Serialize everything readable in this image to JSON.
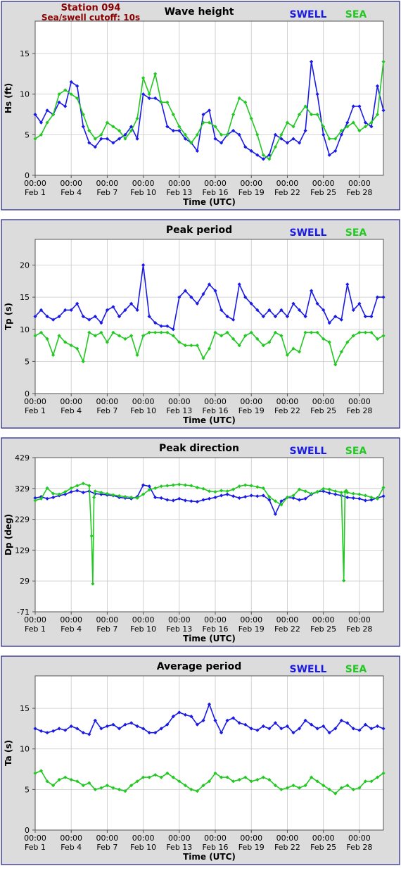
{
  "station": {
    "name": "Station 094",
    "cutoff": "Sea/swell cutoff: 10s"
  },
  "colors": {
    "swell": "#1a1ae6",
    "sea": "#22c822",
    "panel": "#dcdcdc",
    "border": "#1a1a8a"
  },
  "legend": {
    "swell": "SWELL",
    "sea": "SEA"
  },
  "x_axis": {
    "label": "Time (UTC)",
    "tick_days": [
      0,
      3,
      6,
      9,
      12,
      15,
      18,
      21,
      24,
      27
    ],
    "tick_labels_top": [
      "00:00",
      "00:00",
      "00:00",
      "00:00",
      "00:00",
      "00:00",
      "00:00",
      "00:00",
      "00:00",
      "00:00"
    ],
    "tick_labels_bottom": [
      "Feb 1",
      "Feb 4",
      "Feb 7",
      "Feb 10",
      "Feb 13",
      "Feb 16",
      "Feb 19",
      "Feb 22",
      "Feb 25",
      "Feb 28"
    ],
    "range_days": [
      0,
      29
    ]
  },
  "chart_data": [
    {
      "type": "line",
      "title": "Wave height",
      "ylabel": "Hs (ft)",
      "ylim": [
        0,
        19
      ],
      "yticks": [
        0,
        5,
        10,
        15
      ],
      "grid": true,
      "legend_position": "top-right",
      "x_unit": "days since Feb 1 00:00",
      "series": [
        {
          "name": "SWELL",
          "x": [
            0,
            0.5,
            1,
            1.5,
            2,
            2.5,
            3,
            3.5,
            4,
            4.5,
            5,
            5.5,
            6,
            6.5,
            7,
            7.5,
            8,
            8.5,
            9,
            9.5,
            10,
            10.5,
            11,
            11.5,
            12,
            12.5,
            13,
            13.5,
            14,
            14.5,
            15,
            15.5,
            16,
            16.5,
            17,
            17.5,
            18,
            18.5,
            19,
            19.5,
            20,
            20.5,
            21,
            21.5,
            22,
            22.5,
            23,
            23.5,
            24,
            24.5,
            25,
            25.5,
            26,
            26.5,
            27,
            27.5,
            28,
            28.5,
            29
          ],
          "values": [
            7.5,
            6.5,
            8,
            7.5,
            9,
            8.5,
            11.5,
            11,
            6,
            4,
            3.5,
            4.5,
            4.5,
            4,
            4.5,
            5,
            6,
            4.5,
            10,
            9.5,
            9.5,
            9,
            6,
            5.5,
            5.5,
            4.5,
            4,
            3,
            7.5,
            8,
            4.5,
            4,
            5,
            5.5,
            5,
            3.5,
            3,
            2.5,
            2,
            2.5,
            5,
            4.5,
            4,
            4.5,
            4,
            5.5,
            14,
            10,
            5,
            2.5,
            3,
            5,
            6.5,
            8.5,
            8.5,
            6.5,
            6,
            11,
            8
          ]
        },
        {
          "name": "SEA",
          "x": [
            0,
            0.5,
            1,
            1.5,
            2,
            2.5,
            3,
            3.5,
            4,
            4.5,
            5,
            5.5,
            6,
            6.5,
            7,
            7.5,
            8,
            8.5,
            9,
            9.5,
            10,
            10.5,
            11,
            11.5,
            12,
            12.5,
            13,
            13.5,
            14,
            14.5,
            15,
            15.5,
            16,
            16.5,
            17,
            17.5,
            18,
            18.5,
            19,
            19.5,
            20,
            20.5,
            21,
            21.5,
            22,
            22.5,
            23,
            23.5,
            24,
            24.5,
            25,
            25.5,
            26,
            26.5,
            27,
            27.5,
            28,
            28.5,
            29
          ],
          "values": [
            4.5,
            5,
            6.5,
            7.5,
            10,
            10.5,
            10,
            9.5,
            7.5,
            5.5,
            4.5,
            5,
            6.5,
            6,
            5.5,
            4.5,
            5.5,
            7,
            12,
            10,
            12.5,
            9,
            9,
            7.5,
            6,
            5,
            4,
            5,
            6.5,
            6.5,
            6,
            5,
            5,
            7.5,
            9.5,
            9,
            7,
            5,
            2.5,
            2,
            3.5,
            5,
            6.5,
            6,
            7.5,
            8.5,
            7.5,
            7.5,
            6,
            4.5,
            4.5,
            5.5,
            6,
            6.5,
            5.5,
            6,
            6.5,
            7.5,
            14
          ]
        }
      ]
    },
    {
      "type": "line",
      "title": "Peak period",
      "ylabel": "Tp (s)",
      "ylim": [
        0,
        24
      ],
      "yticks": [
        0,
        5,
        10,
        15,
        20
      ],
      "grid": true,
      "legend_position": "top-right",
      "x_unit": "days since Feb 1 00:00",
      "series": [
        {
          "name": "SWELL",
          "x": [
            0,
            0.5,
            1,
            1.5,
            2,
            2.5,
            3,
            3.5,
            4,
            4.5,
            5,
            5.5,
            6,
            6.5,
            7,
            7.5,
            8,
            8.5,
            9,
            9.5,
            10,
            10.5,
            11,
            11.5,
            12,
            12.5,
            13,
            13.5,
            14,
            14.5,
            15,
            15.5,
            16,
            16.5,
            17,
            17.5,
            18,
            18.5,
            19,
            19.5,
            20,
            20.5,
            21,
            21.5,
            22,
            22.5,
            23,
            23.5,
            24,
            24.5,
            25,
            25.5,
            26,
            26.5,
            27,
            27.5,
            28,
            28.5,
            29
          ],
          "values": [
            12,
            13,
            12,
            11.5,
            12,
            13,
            13,
            14,
            12,
            11.5,
            12,
            11,
            13,
            13.5,
            12,
            13,
            14,
            13,
            20,
            12,
            11,
            10.5,
            10.5,
            10,
            15,
            16,
            15,
            14,
            15.5,
            17,
            16,
            13,
            12,
            11.5,
            17,
            15,
            14,
            13,
            12,
            13,
            12,
            13,
            12,
            14,
            13,
            12,
            16,
            14,
            13,
            11,
            12,
            11.5,
            17,
            13,
            14,
            12,
            12,
            15,
            15
          ]
        },
        {
          "name": "SEA",
          "x": [
            0,
            0.5,
            1,
            1.5,
            2,
            2.5,
            3,
            3.5,
            4,
            4.5,
            5,
            5.5,
            6,
            6.5,
            7,
            7.5,
            8,
            8.5,
            9,
            9.5,
            10,
            10.5,
            11,
            11.5,
            12,
            12.5,
            13,
            13.5,
            14,
            14.5,
            15,
            15.5,
            16,
            16.5,
            17,
            17.5,
            18,
            18.5,
            19,
            19.5,
            20,
            20.5,
            21,
            21.5,
            22,
            22.5,
            23,
            23.5,
            24,
            24.5,
            25,
            25.5,
            26,
            26.5,
            27,
            27.5,
            28,
            28.5,
            29
          ],
          "values": [
            9,
            9.5,
            8.5,
            6,
            9,
            8,
            7.5,
            7,
            5,
            9.5,
            9,
            9.5,
            8,
            9.5,
            9,
            8.5,
            9,
            6,
            9,
            9.5,
            9.5,
            9.5,
            9.5,
            9,
            8,
            7.5,
            7.5,
            7.5,
            5.5,
            7,
            9.5,
            9,
            9.5,
            8.5,
            7.5,
            9,
            9.5,
            8.5,
            7.5,
            8,
            9.5,
            9,
            6,
            7,
            6.5,
            9.5,
            9.5,
            9.5,
            8.5,
            8,
            4.5,
            6.5,
            8,
            9,
            9.5,
            9.5,
            9.5,
            8.5,
            9
          ]
        }
      ]
    },
    {
      "type": "line",
      "title": "Peak direction",
      "ylabel": "Dp (deg)",
      "ylim": [
        -71,
        429
      ],
      "yticks": [
        -71,
        29,
        129,
        229,
        329,
        429
      ],
      "grid": true,
      "legend_position": "top-right",
      "x_unit": "days since Feb 1 00:00",
      "series": [
        {
          "name": "SWELL",
          "x": [
            0,
            0.5,
            1,
            1.5,
            2,
            2.5,
            3,
            3.5,
            4,
            4.5,
            5,
            5.5,
            6,
            6.5,
            7,
            7.5,
            8,
            8.5,
            9,
            9.5,
            10,
            10.5,
            11,
            11.5,
            12,
            12.5,
            13,
            13.5,
            14,
            14.5,
            15,
            15.5,
            16,
            16.5,
            17,
            17.5,
            18,
            18.5,
            19,
            19.5,
            20,
            20.5,
            21,
            21.5,
            22,
            22.5,
            23,
            23.5,
            24,
            24.5,
            25,
            25.5,
            26,
            26.5,
            27,
            27.5,
            28,
            28.5,
            29
          ],
          "values": [
            298,
            302,
            296,
            300,
            306,
            310,
            318,
            322,
            316,
            320,
            312,
            310,
            308,
            306,
            300,
            298,
            296,
            302,
            340,
            336,
            300,
            298,
            292,
            290,
            296,
            290,
            288,
            286,
            292,
            296,
            300,
            306,
            310,
            304,
            298,
            302,
            306,
            304,
            306,
            292,
            246,
            288,
            300,
            298,
            292,
            296,
            310,
            318,
            320,
            314,
            310,
            306,
            300,
            298,
            296,
            290,
            292,
            298,
            304
          ]
        },
        {
          "name": "SEA",
          "x": [
            0,
            0.5,
            1,
            1.5,
            2,
            2.5,
            3,
            3.5,
            4,
            4.5,
            4.7,
            4.8,
            4.9,
            5,
            5.5,
            6,
            6.5,
            7,
            7.5,
            8,
            8.5,
            9,
            9.5,
            10,
            10.5,
            11,
            11.5,
            12,
            12.5,
            13,
            13.5,
            14,
            14.5,
            15,
            15.5,
            16,
            16.5,
            17,
            17.5,
            18,
            18.5,
            19,
            19.5,
            20,
            20.5,
            21,
            21.5,
            22,
            22.5,
            23,
            23.5,
            24,
            24.5,
            25,
            25.5,
            25.7,
            25.8,
            25.9,
            26,
            26.5,
            27,
            27.5,
            28,
            28.5,
            29
          ],
          "values": [
            290,
            296,
            330,
            312,
            310,
            318,
            330,
            338,
            345,
            338,
            175,
            20,
            300,
            320,
            316,
            312,
            308,
            305,
            302,
            300,
            298,
            310,
            325,
            330,
            336,
            338,
            340,
            342,
            340,
            338,
            332,
            328,
            320,
            318,
            322,
            320,
            326,
            336,
            340,
            338,
            334,
            330,
            302,
            288,
            276,
            300,
            306,
            326,
            320,
            312,
            318,
            328,
            326,
            320,
            316,
            30,
            318,
            322,
            316,
            312,
            310,
            306,
            300,
            296,
            332
          ]
        }
      ]
    },
    {
      "type": "line",
      "title": "Average period",
      "ylabel": "Ta (s)",
      "ylim": [
        0,
        19
      ],
      "yticks": [
        0,
        5,
        10,
        15
      ],
      "grid": true,
      "legend_position": "top-right",
      "x_unit": "days since Feb 1 00:00",
      "series": [
        {
          "name": "SWELL",
          "x": [
            0,
            0.5,
            1,
            1.5,
            2,
            2.5,
            3,
            3.5,
            4,
            4.5,
            5,
            5.5,
            6,
            6.5,
            7,
            7.5,
            8,
            8.5,
            9,
            9.5,
            10,
            10.5,
            11,
            11.5,
            12,
            12.5,
            13,
            13.5,
            14,
            14.5,
            15,
            15.5,
            16,
            16.5,
            17,
            17.5,
            18,
            18.5,
            19,
            19.5,
            20,
            20.5,
            21,
            21.5,
            22,
            22.5,
            23,
            23.5,
            24,
            24.5,
            25,
            25.5,
            26,
            26.5,
            27,
            27.5,
            28,
            28.5,
            29
          ],
          "values": [
            12.5,
            12.2,
            12,
            12.2,
            12.5,
            12.3,
            12.8,
            12.5,
            12,
            11.8,
            13.5,
            12.5,
            12.8,
            13,
            12.5,
            13,
            13.2,
            12.8,
            12.5,
            12,
            12,
            12.5,
            13,
            14,
            14.5,
            14.2,
            14,
            13,
            13.5,
            15.5,
            13.5,
            12,
            13.5,
            13.8,
            13.2,
            13,
            12.5,
            12.3,
            12.8,
            12.5,
            13.2,
            12.5,
            12.8,
            12,
            12.5,
            13.5,
            13,
            12.5,
            12.8,
            12,
            12.5,
            13.5,
            13.2,
            12.5,
            12.3,
            13,
            12.5,
            12.8,
            12.5
          ]
        },
        {
          "name": "SEA",
          "x": [
            0,
            0.5,
            1,
            1.5,
            2,
            2.5,
            3,
            3.5,
            4,
            4.5,
            5,
            5.5,
            6,
            6.5,
            7,
            7.5,
            8,
            8.5,
            9,
            9.5,
            10,
            10.5,
            11,
            11.5,
            12,
            12.5,
            13,
            13.5,
            14,
            14.5,
            15,
            15.5,
            16,
            16.5,
            17,
            17.5,
            18,
            18.5,
            19,
            19.5,
            20,
            20.5,
            21,
            21.5,
            22,
            22.5,
            23,
            23.5,
            24,
            24.5,
            25,
            25.5,
            26,
            26.5,
            27,
            27.5,
            28,
            28.5,
            29
          ],
          "values": [
            7,
            7.3,
            6,
            5.5,
            6.2,
            6.5,
            6.2,
            6,
            5.5,
            5.8,
            5,
            5.2,
            5.5,
            5.2,
            5,
            4.8,
            5.5,
            6,
            6.5,
            6.5,
            6.8,
            6.5,
            7,
            6.5,
            6,
            5.5,
            5,
            4.8,
            5.5,
            6,
            7,
            6.5,
            6.5,
            6,
            6.2,
            6.5,
            6,
            6.2,
            6.5,
            6.2,
            5.5,
            5,
            5.2,
            5.5,
            5.2,
            5.5,
            6.5,
            6,
            5.5,
            5,
            4.5,
            5.2,
            5.5,
            5,
            5.2,
            6,
            6,
            6.5,
            7
          ]
        }
      ]
    }
  ]
}
